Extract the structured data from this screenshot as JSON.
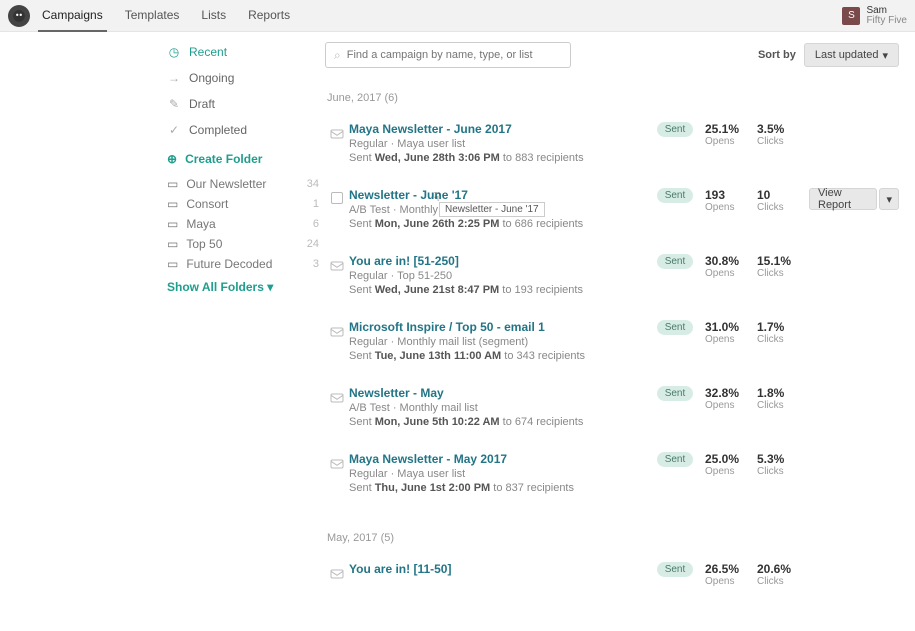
{
  "header": {
    "nav": [
      "Campaigns",
      "Templates",
      "Lists",
      "Reports"
    ],
    "active_nav_index": 0,
    "user": {
      "initial": "S",
      "name": "Sam",
      "org": "Fifty Five"
    }
  },
  "sidebar": {
    "filters": [
      {
        "label": "Recent",
        "icon": "clock-icon",
        "active": true
      },
      {
        "label": "Ongoing",
        "icon": "arrow-right-icon",
        "active": false
      },
      {
        "label": "Draft",
        "icon": "pencil-icon",
        "active": false
      },
      {
        "label": "Completed",
        "icon": "check-icon",
        "active": false
      }
    ],
    "create_label": "Create Folder",
    "folders": [
      {
        "label": "Our Newsletter",
        "count": "34"
      },
      {
        "label": "Consort",
        "count": "1"
      },
      {
        "label": "Maya",
        "count": "6"
      },
      {
        "label": "Top 50",
        "count": "24"
      },
      {
        "label": "Future Decoded",
        "count": "3"
      }
    ],
    "show_all_label": "Show All Folders"
  },
  "search": {
    "placeholder": "Find a campaign by name, type, or list"
  },
  "sort": {
    "label": "Sort by",
    "selected": "Last updated"
  },
  "actions": {
    "view_report": "View Report"
  },
  "sections": [
    {
      "label": "June, 2017 (6)"
    },
    {
      "label": "May, 2017 (5)"
    }
  ],
  "status_labels": {
    "sent": "Sent"
  },
  "stat_labels": {
    "opens": "Opens",
    "clicks": "Clicks"
  },
  "tooltip": "Newsletter - June '17",
  "campaigns": [
    {
      "title": "Maya Newsletter - June 2017",
      "meta": "Regular · Maya user list",
      "sent_prefix": "Sent ",
      "sent_bold": "Wed, June 28th 3:06 PM",
      "sent_suffix": " to 883 recipients",
      "opens": "25.1%",
      "clicks": "3.5%",
      "hovered": false
    },
    {
      "title": "Newsletter - June '17",
      "meta": "A/B Test · Monthly mail list",
      "sent_prefix": "Sent ",
      "sent_bold": "Mon, June 26th 2:25 PM",
      "sent_suffix": " to 686 recipients",
      "opens": "193",
      "clicks": "10",
      "hovered": true
    },
    {
      "title": "You are in! [51-250]",
      "meta": "Regular · Top 51-250",
      "sent_prefix": "Sent ",
      "sent_bold": "Wed, June 21st 8:47 PM",
      "sent_suffix": " to 193 recipients",
      "opens": "30.8%",
      "clicks": "15.1%",
      "hovered": false
    },
    {
      "title": "Microsoft Inspire / Top 50 - email 1",
      "meta": "Regular · Monthly mail list (segment)",
      "sent_prefix": "Sent ",
      "sent_bold": "Tue, June 13th 11:00 AM",
      "sent_suffix": " to 343 recipients",
      "opens": "31.0%",
      "clicks": "1.7%",
      "hovered": false
    },
    {
      "title": "Newsletter - May",
      "meta": "A/B Test · Monthly mail list",
      "sent_prefix": "Sent ",
      "sent_bold": "Mon, June 5th 10:22 AM",
      "sent_suffix": " to 674 recipients",
      "opens": "32.8%",
      "clicks": "1.8%",
      "hovered": false
    },
    {
      "title": "Maya Newsletter - May 2017",
      "meta": "Regular · Maya user list",
      "sent_prefix": "Sent ",
      "sent_bold": "Thu, June 1st 2:00 PM",
      "sent_suffix": " to 837 recipients",
      "opens": "25.0%",
      "clicks": "5.3%",
      "hovered": false
    },
    {
      "title": "You are in! [11-50]",
      "meta": "",
      "sent_prefix": "",
      "sent_bold": "",
      "sent_suffix": "",
      "opens": "26.5%",
      "clicks": "20.6%",
      "hovered": false,
      "section": 1
    }
  ]
}
